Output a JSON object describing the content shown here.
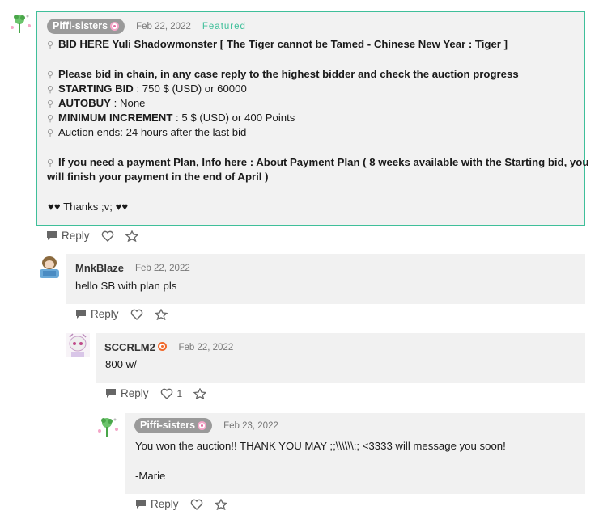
{
  "thread": {
    "main": {
      "author": "Piffi-sisters",
      "date": "Feb 22, 2022",
      "tag": "Featured",
      "lines": [
        {
          "bold": "BID HERE",
          "rest": "  Yuli Shadowmonster [ The Tiger cannot be Tamed - Chinese New Year : Tiger ]"
        },
        {
          "bold": "Please bid in chain, in any case reply to the highest bidder and check the auction progress",
          "rest": ""
        },
        {
          "bold": "STARTING BID",
          "rest": " : 750 $ (USD) or 60000"
        },
        {
          "bold": "AUTOBUY",
          "rest": " : None"
        },
        {
          "bold": "MINIMUM INCREMENT",
          "rest": " :  5 $ (USD) or 400  Points"
        },
        {
          "bold": "",
          "rest": "Auction ends: 24 hours after the last bid"
        }
      ],
      "payment_prefix": "If you need a payment Plan, Info here : ",
      "payment_link": "About Payment Plan",
      "payment_suffix": " ( 8 weeks available with the Starting bid, you",
      "payment_line2": "will finish your payment in the end of April )",
      "thanks": "♥♥ Thanks ;v; ♥♥",
      "reply_label": "Reply"
    },
    "c1": {
      "author": "MnkBlaze",
      "date": "Feb 22, 2022",
      "text": "hello SB with plan pls",
      "reply_label": "Reply"
    },
    "c2": {
      "author": "SCCRLM2",
      "date": "Feb 22, 2022",
      "text": "800 w/",
      "reply_label": "Reply",
      "likes": "1"
    },
    "c3": {
      "author": "Piffi-sisters",
      "date": "Feb 23, 2022",
      "text": "You won the auction!! THANK YOU MAY ;;\\\\\\\\\\\\;; <3333 will message you soon!",
      "sign": "-Marie",
      "reply_label": "Reply"
    }
  },
  "icons": {
    "reply": "reply-icon",
    "heart": "heart-icon",
    "star": "star-icon",
    "pin": "pin-icon"
  },
  "colors": {
    "featured_border": "#3fbf9a",
    "comment_bg": "#f1f1f1",
    "pill_bg": "#9a9a9a"
  }
}
